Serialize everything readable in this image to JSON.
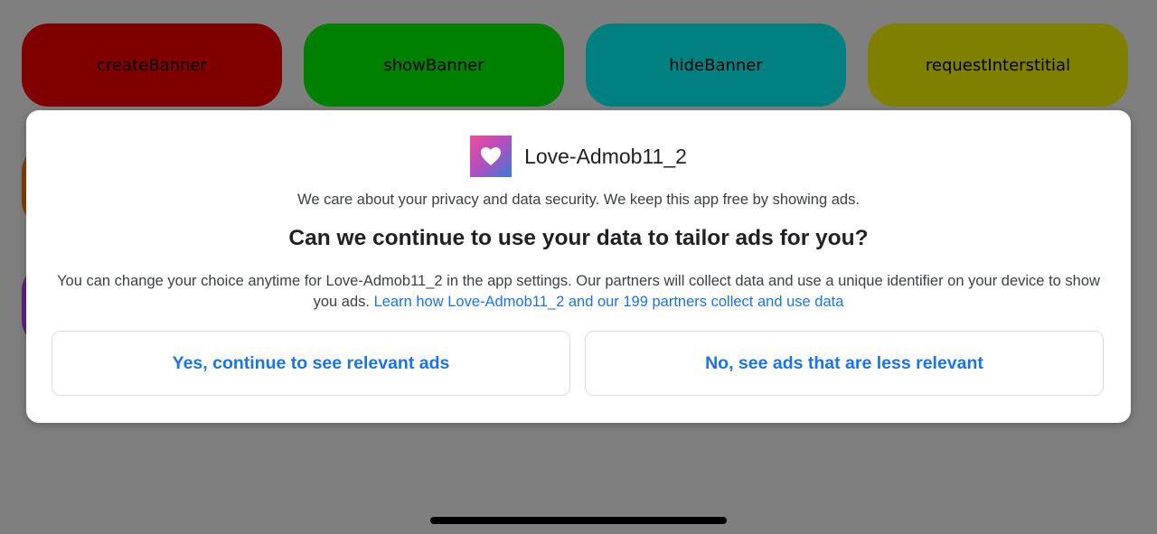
{
  "background_buttons": {
    "create_banner": "createBanner",
    "show_banner": "showBanner",
    "hide_banner": "hideBanner",
    "request_interstitial": "requestInterstitial"
  },
  "dialog": {
    "app_name": "Love-Admob11_2",
    "app_icon": "heart-icon",
    "tagline": "We care about your privacy and data security. We keep this app free by showing ads.",
    "question": "Can we continue to use your data to tailor ads for you?",
    "body": "You can change your choice anytime for Love-Admob11_2 in the app settings. Our partners will collect data and use a unique identifier on your device to show you ads.",
    "learn_link": "Learn how Love-Admob11_2 and our 199 partners collect and use data",
    "yes_button": "Yes, continue to see relevant ads",
    "no_button": "No, see ads that are less relevant"
  },
  "colors": {
    "link": "#1a73e8",
    "scrim": "#7f7f7f",
    "btn_red": "#800000",
    "btn_green": "#008000",
    "btn_teal": "#008080",
    "btn_olive": "#808000"
  }
}
